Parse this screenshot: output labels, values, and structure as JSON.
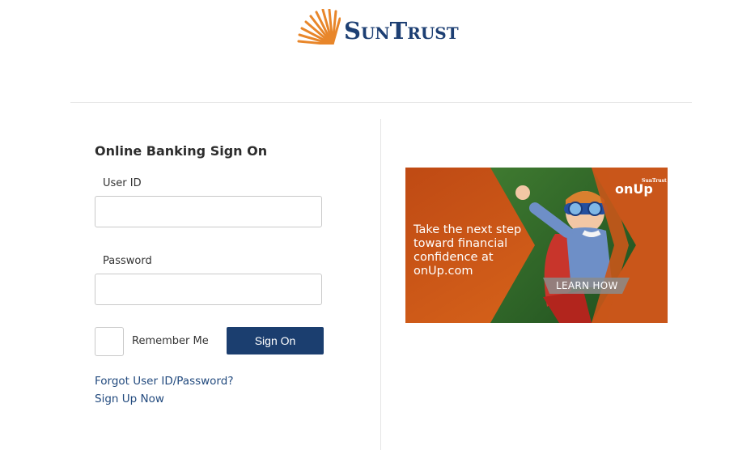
{
  "brand": {
    "name": "SunTrust"
  },
  "login": {
    "heading": "Online Banking Sign On",
    "user_label": "User ID",
    "user_value": "",
    "password_label": "Password",
    "password_value": "",
    "remember_label": "Remember Me",
    "signon_label": "Sign On",
    "forgot_link": "Forgot User ID/Password?",
    "signup_link": "Sign Up Now"
  },
  "ad": {
    "text": "Take the next step toward financial confidence at onUp.com",
    "button": "LEARN HOW",
    "logo": "onUp",
    "logo_small": "SunTrust"
  },
  "colors": {
    "brand_navy": "#1b3e6f",
    "brand_orange": "#e8862a",
    "link": "#224a7e",
    "ad_orange": "#d95f17",
    "ad_green": "#2f6b2a"
  },
  "icons": {
    "logo_mark": "sunburst-icon",
    "ad_image": "child-superhero-photo"
  }
}
